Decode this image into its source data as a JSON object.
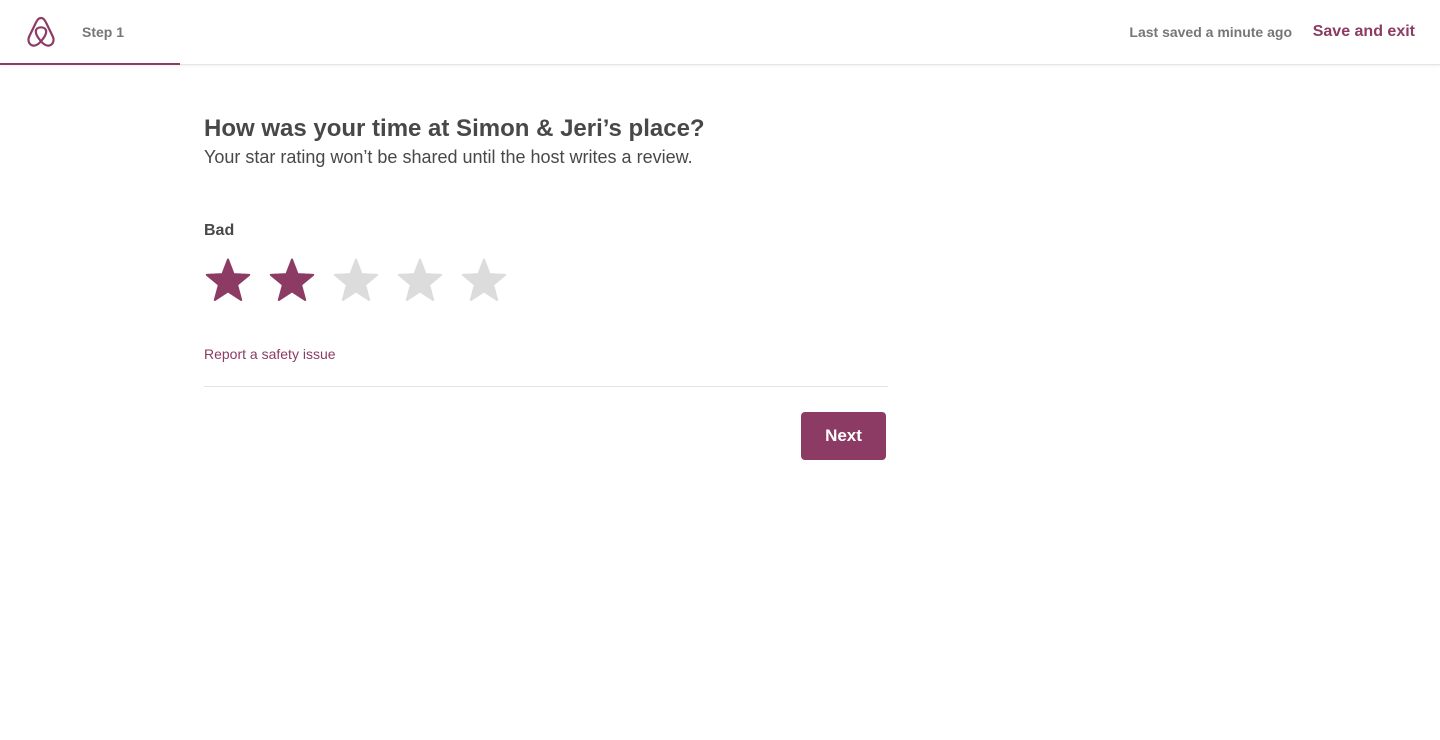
{
  "header": {
    "logo_icon": "airbnb-belo-icon",
    "step_label": "Step 1",
    "progress_fraction": 0.125,
    "last_saved": "Last saved a minute ago",
    "save_exit_label": "Save and exit"
  },
  "main": {
    "title": "How was your time at Simon & Jeri’s place?",
    "subtitle": "Your star rating won’t be shared until the host writes a review.",
    "rating_label": "Bad",
    "rating": {
      "value": 2,
      "max": 5,
      "filled_color": "#8c3b64",
      "empty_color": "#dcdcdc",
      "star_icon": "star-icon"
    },
    "report_link": "Report a safety issue",
    "next_label": "Next"
  },
  "colors": {
    "accent": "#8c3b64",
    "text": "#484848",
    "muted": "#767676"
  }
}
